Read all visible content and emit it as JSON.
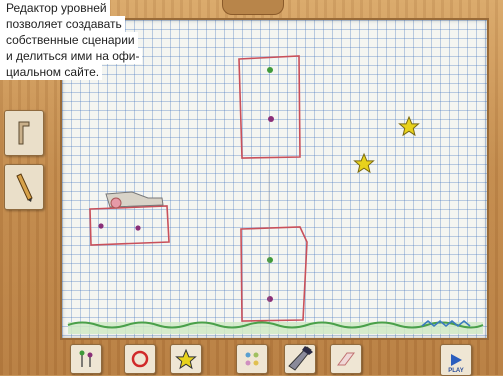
{
  "caption": {
    "lines": [
      "Редактор уровней",
      "позволяет создавать",
      "собственные сценарии",
      "и делиться ими на офи-",
      "циальном сайте."
    ]
  },
  "canvas": {
    "shapes": [
      "rectangle",
      "rectangle",
      "rectangle"
    ],
    "items": [
      "star-icon",
      "star-icon"
    ]
  },
  "side_toolbar": {
    "items": [
      {
        "icon": "pencil-tool-icon"
      },
      {
        "icon": "pencil-draw-icon"
      }
    ]
  },
  "bottom_toolbar": {
    "items": [
      {
        "icon": "pin-tool-icon"
      },
      {
        "icon": "ring-tool-icon"
      },
      {
        "icon": "star-tool-icon"
      },
      {
        "icon": "palette-icon"
      },
      {
        "icon": "brush-icon"
      },
      {
        "icon": "eraser-icon"
      },
      {
        "icon": "play-icon",
        "label": "PLAY"
      }
    ]
  },
  "colors": {
    "wood": "#c8965a",
    "grid": "#4678be",
    "shape_stroke": "#c9505a",
    "dot_green": "#3f9a3a",
    "dot_purple": "#8a2f78",
    "star": "#e8d21c",
    "grass": "#4aa04a"
  }
}
